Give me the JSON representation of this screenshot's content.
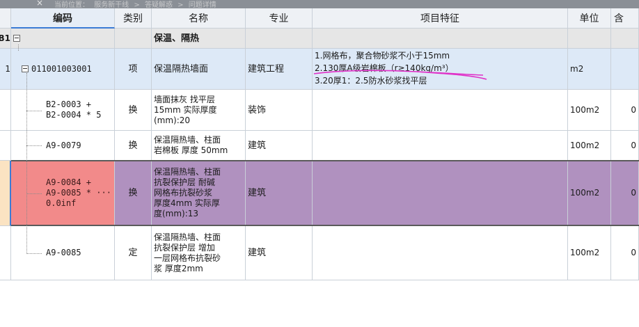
{
  "breadcrumb": {
    "close": "×",
    "label": "当前位置：",
    "path": [
      "服务新干线",
      ">",
      "答疑解惑",
      ">",
      "问题详情"
    ]
  },
  "columns": {
    "row_no": "",
    "code": "编码",
    "category": "类别",
    "name": "名称",
    "specialty": "专业",
    "features": "项目特征",
    "unit": "单位",
    "qty": "含"
  },
  "rows": [
    {
      "row_no": "B1",
      "code": "",
      "category": "",
      "name": "保温、隔热",
      "specialty": "",
      "features": [],
      "unit": "",
      "qty": ""
    },
    {
      "row_no": "1",
      "code": "011001003001",
      "category": "项",
      "name": "保温隔热墙面",
      "specialty": "建筑工程",
      "features": [
        "1.网格布，聚合物砂浆不小于15mm",
        "2.130厚A级岩棉板（r≥140kg/m³）",
        "3.20厚1：2.5防水砂浆找平层"
      ],
      "unit": "m2",
      "qty": ""
    },
    {
      "row_no": "",
      "code": "B2-0003 +\nB2-0004 * 5",
      "category": "换",
      "name": "墙面抹灰 找平层\n15mm  实际厚度\n(mm):20",
      "specialty": "装饰",
      "features": [],
      "unit": "100m2",
      "qty": "0"
    },
    {
      "row_no": "",
      "code": "A9-0079",
      "category": "换",
      "name": "保温隔热墙、柱面\n岩棉板 厚度 50mm",
      "specialty": "建筑",
      "features": [],
      "unit": "100m2",
      "qty": "0"
    },
    {
      "row_no": "",
      "code": "A9-0084 +\nA9-0085 * ···\n0.0inf",
      "category": "换",
      "name": "保温隔热墙、柱面\n抗裂保护层 耐碱\n网格布抗裂砂浆\n厚度4mm  实际厚\n度(mm):13",
      "specialty": "建筑",
      "features": [],
      "unit": "100m2",
      "qty": "0"
    },
    {
      "row_no": "",
      "code": "A9-0085",
      "category": "定",
      "name": "保温隔热墙、柱面\n抗裂保护层 增加\n一层网格布抗裂砂\n浆 厚度2mm",
      "specialty": "建筑",
      "features": [],
      "unit": "100m2",
      "qty": "0"
    }
  ],
  "colors": {
    "header_bg": "#eef1f5",
    "group_row_bg": "#e6e6e6",
    "item_row_bg": "#dde9f7",
    "selected_row_bg": "#b091bf",
    "selected_code_bg": "#f28a8a",
    "row_marker_bg": "#fbe3c2",
    "annotation_pen": "#e030c8"
  }
}
